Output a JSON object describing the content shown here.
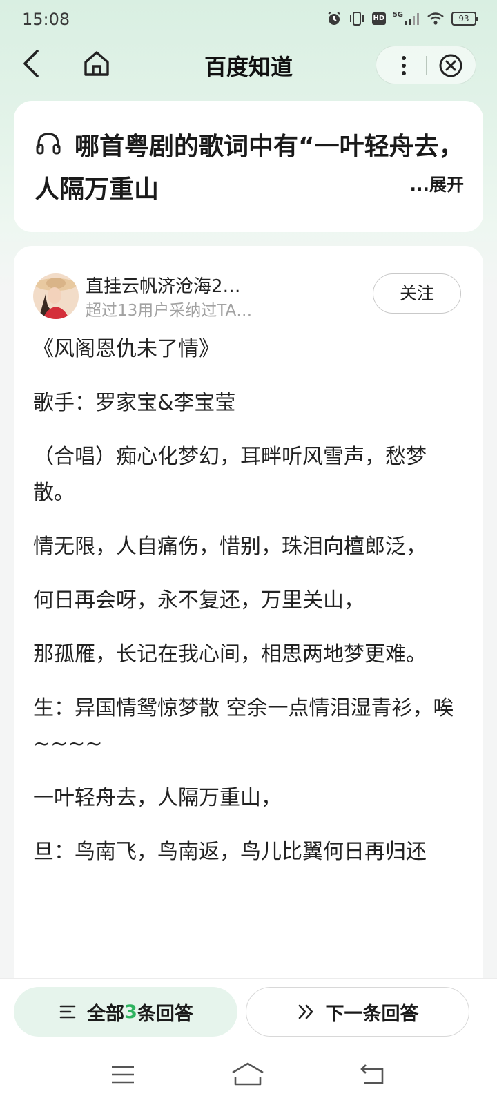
{
  "status_bar": {
    "time": "15:08",
    "signal_label": "5G",
    "hd_label": "HD",
    "battery": "93",
    "icons": [
      "alarm-icon",
      "vibrate-icon",
      "hd-icon",
      "signal-5g-icon",
      "wifi-icon",
      "battery-icon"
    ]
  },
  "nav": {
    "title": "百度知道",
    "icons": [
      "back-icon",
      "home-icon",
      "more-icon",
      "close-icon"
    ]
  },
  "question": {
    "icon": "headphones-icon",
    "text": "哪首粤剧的歌词中有“一叶轻舟去，人隔万重山",
    "expand_label": "...展开"
  },
  "answer": {
    "author_name": "直挂云帆济沧海2…",
    "author_sub": "超过13用户采纳过TA…",
    "follow_label": "关注",
    "lines": [
      "《风阁恩仇未了情》",
      "歌手：罗家宝&李宝莹",
      "（合唱）痴心化梦幻，耳畔听风雪声，愁梦散。",
      "情无限，人自痛伤，惜别，珠泪向檀郎泛，",
      "何日再会呀，永不复还，万里关山，",
      "那孤雁，长记在我心间，相思两地梦更难。",
      "生：异国情鸳惊梦散 空余一点情泪湿青衫，唉~~~~",
      "一叶轻舟去，人隔万重山，",
      "旦：鸟南飞，鸟南返，鸟儿比翼何日再归还"
    ]
  },
  "bottom_bar": {
    "all_prefix": "全部",
    "all_count": "3",
    "all_suffix": "条回答",
    "next_label": "下一条回答",
    "accent_color": "#2eb35f"
  },
  "system_nav": {
    "icons": [
      "menu-icon",
      "home-outline-icon",
      "back-arrow-icon"
    ]
  }
}
